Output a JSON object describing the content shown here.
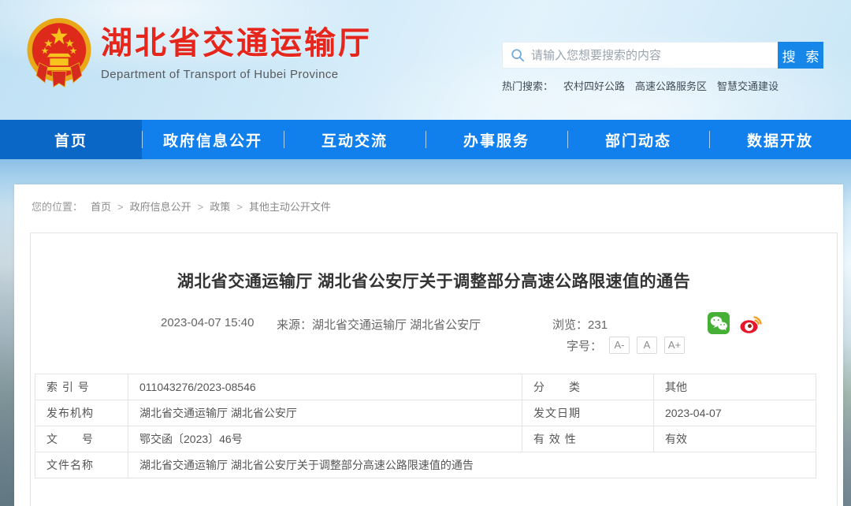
{
  "header": {
    "site_title": "湖北省交通运输厅",
    "site_subtitle": "Department of Transport of Hubei Province",
    "search": {
      "placeholder": "请输入您想要搜索的内容",
      "button_label": "搜 索"
    },
    "hot_search": {
      "label": "热门搜索：",
      "links": [
        "农村四好公路",
        "高速公路服务区",
        "智慧交通建设"
      ]
    }
  },
  "nav": {
    "items": [
      {
        "label": "首页"
      },
      {
        "label": "政府信息公开"
      },
      {
        "label": "互动交流"
      },
      {
        "label": "办事服务"
      },
      {
        "label": "部门动态"
      },
      {
        "label": "数据开放"
      }
    ]
  },
  "breadcrumb": {
    "label": "您的位置：",
    "separator": ">",
    "items": [
      "首页",
      "政府信息公开",
      "政策",
      "其他主动公开文件"
    ]
  },
  "article": {
    "title": "湖北省交通运输厅 湖北省公安厅关于调整部分高速公路限速值的通告",
    "publish_time": "2023-04-07 15:40",
    "source_label": "来源：",
    "source": "湖北省交通运输厅 湖北省公安厅",
    "views_label": "浏览：",
    "views": "231",
    "fontsize_label": "字号：",
    "fontsize_options": [
      "A-",
      "A",
      "A+"
    ],
    "share_icons": [
      "wechat-icon",
      "weibo-icon"
    ]
  },
  "doc_table": {
    "rows": [
      {
        "label1": "索 引 号",
        "value1": "011043276/2023-08546",
        "label2": "分　　类",
        "value2": "其他"
      },
      {
        "label1": "发布机构",
        "value1": "湖北省交通运输厅 湖北省公安厅",
        "label2": "发文日期",
        "value2": "2023-04-07"
      },
      {
        "label1": "文　　号",
        "value1": "鄂交函〔2023〕46号",
        "label2": "有 效 性",
        "value2": "有效"
      },
      {
        "label1": "文件名称",
        "value1": "湖北省交通运输厅 湖北省公安厅关于调整部分高速公路限速值的通告"
      }
    ]
  },
  "colors": {
    "brand_red": "#e5261d",
    "nav_blue": "#1180ec",
    "nav_active_blue": "#0b67c6",
    "search_button_blue": "#1687e8",
    "wechat_green": "#45b035",
    "weibo_red": "#e6162d"
  }
}
